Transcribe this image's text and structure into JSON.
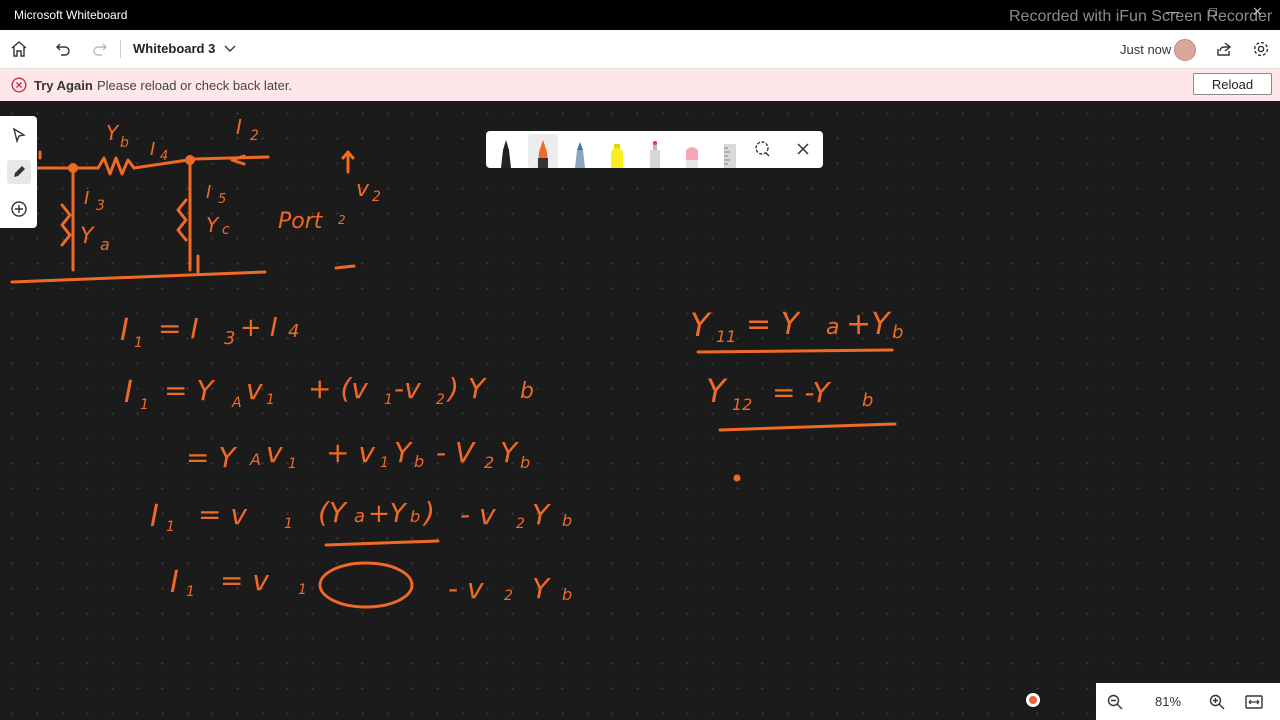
{
  "titlebar": {
    "app_name": "Microsoft Whiteboard",
    "watermark": "Recorded with iFun Screen Recorder"
  },
  "toolbar": {
    "board_name": "Whiteboard 3",
    "save_status": "Just now"
  },
  "banner": {
    "title": "Try Again",
    "message": "Please reload or check back later.",
    "reload_label": "Reload"
  },
  "zoom": {
    "level": "81%"
  },
  "icons": {
    "home": "home-icon",
    "undo": "undo-icon",
    "redo": "redo-icon",
    "share": "share-icon",
    "settings": "settings-icon",
    "select": "select-icon",
    "pen": "pen-icon",
    "add": "add-icon",
    "zoom_out": "zoom-out-icon",
    "zoom_in": "zoom-in-icon",
    "fit": "fit-to-screen-icon"
  },
  "colors": {
    "ink": "#f06a25",
    "banner_bg": "#fde7e9",
    "canvas_bg": "#1b1b1b",
    "error": "#c4314b"
  }
}
